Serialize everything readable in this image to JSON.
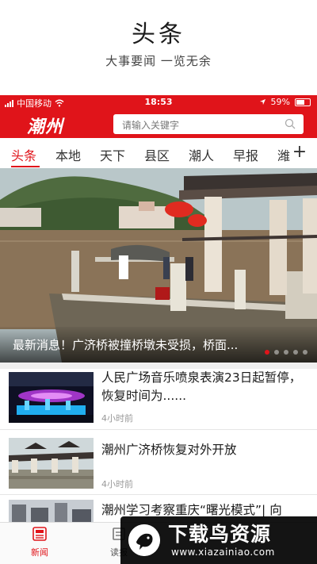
{
  "promo": {
    "title": "头条",
    "subtitle": "大事要闻 一览无余"
  },
  "statusbar": {
    "carrier": "中国移动",
    "time": "18:53",
    "battery": "59%"
  },
  "appbar": {
    "logo": "潮州",
    "search_placeholder": "请输入关键字"
  },
  "tabs": [
    {
      "label": "头条",
      "active": true
    },
    {
      "label": "本地",
      "active": false
    },
    {
      "label": "天下",
      "active": false
    },
    {
      "label": "县区",
      "active": false
    },
    {
      "label": "潮人",
      "active": false
    },
    {
      "label": "早报",
      "active": false
    },
    {
      "label": "潍",
      "active": false
    }
  ],
  "tabs_more": "+",
  "hero": {
    "caption": "最新消息！广济桥被撞桥墩未受损，桥面...",
    "slides_total": 5,
    "slide_active": 1
  },
  "news": [
    {
      "title": "人民广场音乐喷泉表演23日起暂停，恢复时间为......",
      "time": "4小时前"
    },
    {
      "title": "潮州广济桥恢复对外开放",
      "time": "4小时前"
    },
    {
      "title": "潮州学习考察重庆“曙光模式”| 向",
      "time": ""
    }
  ],
  "bottom_nav": [
    {
      "label": "新闻",
      "icon": "news-icon",
      "active": true
    },
    {
      "label": "读报",
      "icon": "newspaper-icon",
      "active": false
    }
  ],
  "watermark": {
    "title": "下载鸟资源",
    "url": "www.xiazainiao.com"
  },
  "colors": {
    "brand": "#e0141a",
    "text": "#1b1b1b",
    "muted": "#999999"
  }
}
